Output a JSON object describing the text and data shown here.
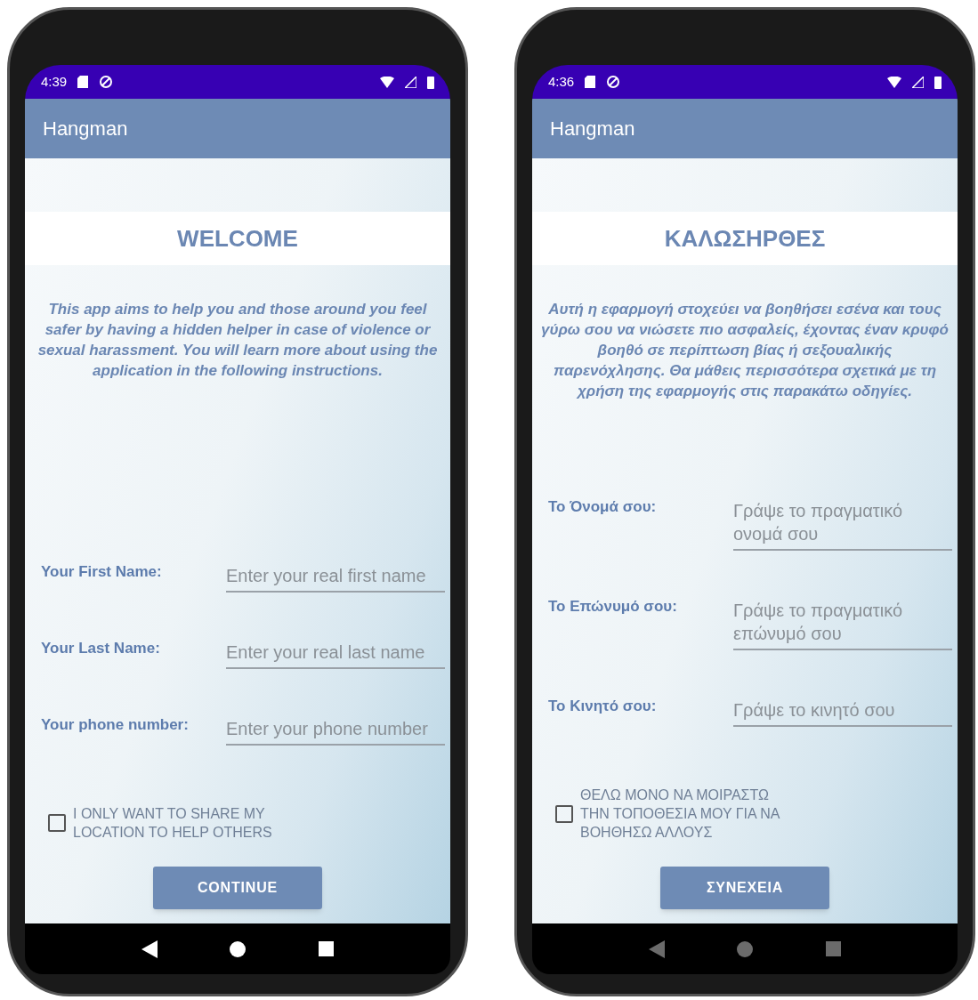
{
  "phones": [
    {
      "status_time": "4:39",
      "app_title": "Hangman",
      "heading": "WELCOME",
      "intro": "This app aims to help you and those around you feel safer by having a hidden helper in case of violence or sexual harassment. You will learn more about using the application in the following instructions.",
      "fields": [
        {
          "label": "Your First Name:",
          "placeholder": "Enter your real first name"
        },
        {
          "label": "Your Last Name:",
          "placeholder": "Enter your real last name"
        },
        {
          "label": "Your phone number:",
          "placeholder": "Enter your phone number"
        }
      ],
      "checkbox": {
        "label": "I ONLY WANT TO SHARE MY LOCATION TO HELP OTHERS",
        "checked": false
      },
      "button": "CONTINUE",
      "nav_dimmed": false
    },
    {
      "status_time": "4:36",
      "app_title": "Hangman",
      "heading": "ΚΑΛΩΣΗΡΘΕΣ",
      "intro": "Αυτή η εφαρμογή στοχεύει να βοηθήσει εσένα και τους γύρω σου να νιώσετε πιο ασφαλείς, έχοντας έναν κρυφό βοηθό σε περίπτωση βίας ή σεξουαλικής παρενόχλησης. Θα μάθεις περισσότερα σχετικά με τη χρήση της εφαρμογής στις παρακάτω οδηγίες.",
      "fields": [
        {
          "label": "Το Όνομά σου:",
          "placeholder": "Γράψε το πραγματικό ονομά σου"
        },
        {
          "label": "Το Επώνυμό σου:",
          "placeholder": "Γράψε το πραγματικό επώνυμό σου"
        },
        {
          "label": "Το Κινητό σου:",
          "placeholder": "Γράψε το κινητό σου"
        }
      ],
      "checkbox": {
        "label": "ΘΕΛΩ ΜΟΝΟ ΝΑ ΜΟΙΡΑΣΤΩ ΤΗΝ ΤΟΠΟΘΕΣΙΑ ΜΟΥ ΓΙΑ ΝΑ ΒΟΗΘΗΣΩ ΑΛΛΟΥΣ",
        "checked": false
      },
      "button": "ΣΥΝΕΧΕΙΑ",
      "nav_dimmed": true
    }
  ]
}
